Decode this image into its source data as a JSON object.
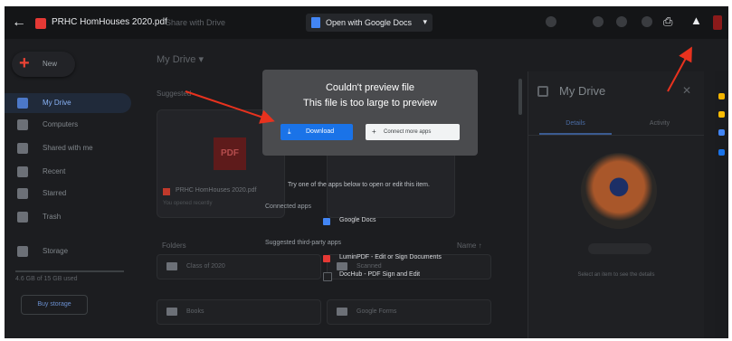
{
  "topbar": {
    "file_name": "PRHC HomHouses 2020.pdf",
    "share_hint": "Share with Drive",
    "open_with": "Open with Google Docs",
    "caret": "▾",
    "back_icon": "←",
    "print_icon": "⎙",
    "drive_add_icon": "▲"
  },
  "sidebar": {
    "new_label": "New",
    "items": [
      {
        "label": "My Drive",
        "active": true
      },
      {
        "label": "Computers",
        "active": false
      },
      {
        "label": "Shared with me",
        "active": false
      },
      {
        "label": "Recent",
        "active": false
      },
      {
        "label": "Starred",
        "active": false
      },
      {
        "label": "Trash",
        "active": false
      },
      {
        "label": "Storage",
        "active": false
      }
    ],
    "storage_text": "4.6 GB of 15 GB used",
    "buy_storage": "Buy storage"
  },
  "main": {
    "breadcrumb": "My Drive ▾",
    "suggested": "Suggested",
    "card_name": "PRHC HomHouses 2020.pdf",
    "card_sub": "You opened recently",
    "pdf_thumb": "PDF",
    "folders_label": "Folders",
    "name_sort": "Name ↑",
    "folders": [
      "Class of 2020",
      "Books",
      "Scanned",
      "Google Forms"
    ]
  },
  "dialog": {
    "title": "Couldn't preview file",
    "message": "This file is too large to preview",
    "download": "Download",
    "connect": "Connect more apps"
  },
  "open_with": {
    "help": "Try one of the apps below to open or edit this item.",
    "connected_label": "Connected apps",
    "connected": [
      {
        "label": "Google Docs",
        "color": "#4285f4"
      }
    ],
    "suggested_label": "Suggested third-party apps",
    "suggested": [
      {
        "label": "LuminPDF - Edit or Sign Documents",
        "color": "#e53935"
      },
      {
        "label": "DocHub - PDF Sign and Edit",
        "color": "#202124"
      }
    ]
  },
  "details": {
    "title": "My Drive",
    "tab_details": "Details",
    "tab_activity": "Activity",
    "hint": "Select an item to see the details",
    "close_icon": "✕"
  },
  "colors": {
    "accent": "#1a73e8",
    "annotation": "#e8321e"
  }
}
